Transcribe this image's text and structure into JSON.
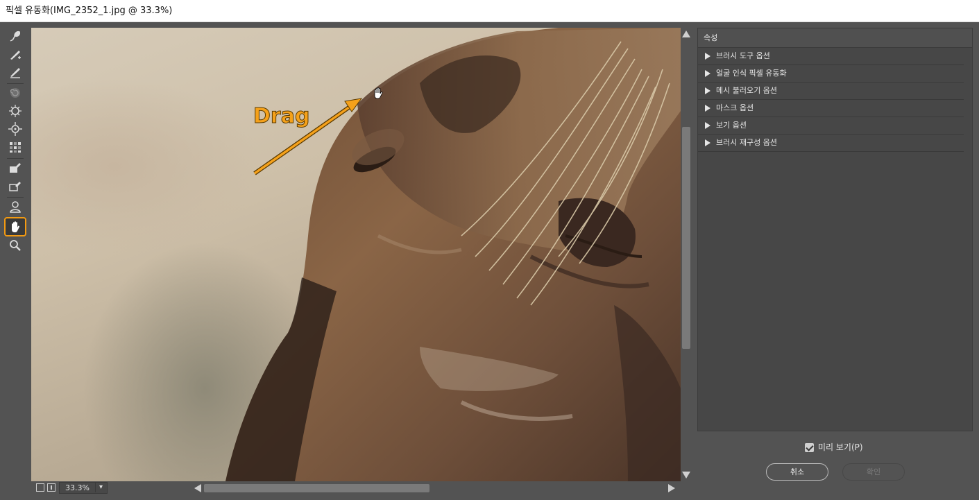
{
  "window": {
    "title": "픽셀 유동화(IMG_2352_1.jpg @ 33.3%)"
  },
  "toolbar": {
    "tools": [
      {
        "name": "forward-warp-tool-icon"
      },
      {
        "name": "reconstruct-tool-icon"
      },
      {
        "name": "smooth-tool-icon"
      },
      {
        "name": "twirl-tool-icon"
      },
      {
        "name": "pucker-tool-icon"
      },
      {
        "name": "bloat-tool-icon"
      },
      {
        "name": "push-left-tool-icon"
      },
      {
        "name": "freeze-mask-tool-icon"
      },
      {
        "name": "thaw-mask-tool-icon"
      },
      {
        "name": "face-tool-icon"
      },
      {
        "name": "hand-tool-icon",
        "active": true
      },
      {
        "name": "zoom-tool-icon"
      }
    ]
  },
  "canvas": {
    "annotation_text": "Drag",
    "annotation_color": "#f5a11a"
  },
  "statusbar": {
    "zoom": "33.3%"
  },
  "panel": {
    "title": "속성",
    "sections": [
      "브러시 도구 옵션",
      "얼굴 인식 픽셀 유동화",
      "메시 불러오기 옵션",
      "마스크 옵션",
      "보기 옵션",
      "브러시 재구성 옵션"
    ]
  },
  "footer": {
    "preview_label": "미리 보기(P)",
    "preview_checked": true,
    "cancel_label": "취소",
    "ok_label": "확인"
  }
}
